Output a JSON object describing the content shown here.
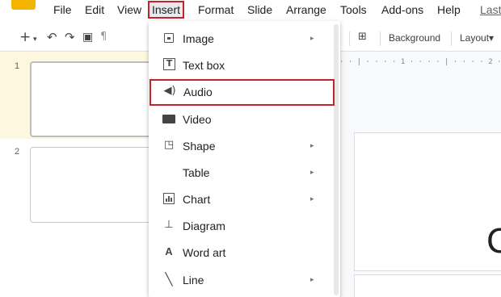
{
  "menubar": {
    "items": [
      "File",
      "Edit",
      "View",
      "Insert",
      "Format",
      "Slide",
      "Arrange",
      "Tools",
      "Add-ons",
      "Help"
    ],
    "last_edit_label": "Last"
  },
  "toolbar": {
    "background_label": "Background",
    "layout_label": "Layout▾"
  },
  "ruler": {
    "text": "· · | · · · · 1 · · · · | · · · · 2 · · · | ·"
  },
  "filmstrip": {
    "slides": [
      "1",
      "2"
    ]
  },
  "canvas": {
    "visible_text": "C"
  },
  "insert_menu": {
    "items": [
      {
        "label": "Image",
        "icon": "image-icon",
        "has_submenu": true
      },
      {
        "label": "Text box",
        "icon": "text-box-icon",
        "has_submenu": false
      },
      {
        "label": "Audio",
        "icon": "audio-icon",
        "has_submenu": false,
        "highlighted": true
      },
      {
        "label": "Video",
        "icon": "video-icon",
        "has_submenu": false
      },
      {
        "label": "Shape",
        "icon": "shape-icon",
        "has_submenu": true
      },
      {
        "label": "Table",
        "icon": "",
        "has_submenu": true
      },
      {
        "label": "Chart",
        "icon": "chart-icon",
        "has_submenu": true
      },
      {
        "label": "Diagram",
        "icon": "diagram-icon",
        "has_submenu": false
      },
      {
        "label": "Word art",
        "icon": "word-art-icon",
        "has_submenu": false
      },
      {
        "label": "Line",
        "icon": "line-icon",
        "has_submenu": true
      }
    ]
  },
  "colors": {
    "highlight_border": "#c5222a",
    "selected_slide_bg": "#fef7e0",
    "logo": "#f4b400"
  }
}
